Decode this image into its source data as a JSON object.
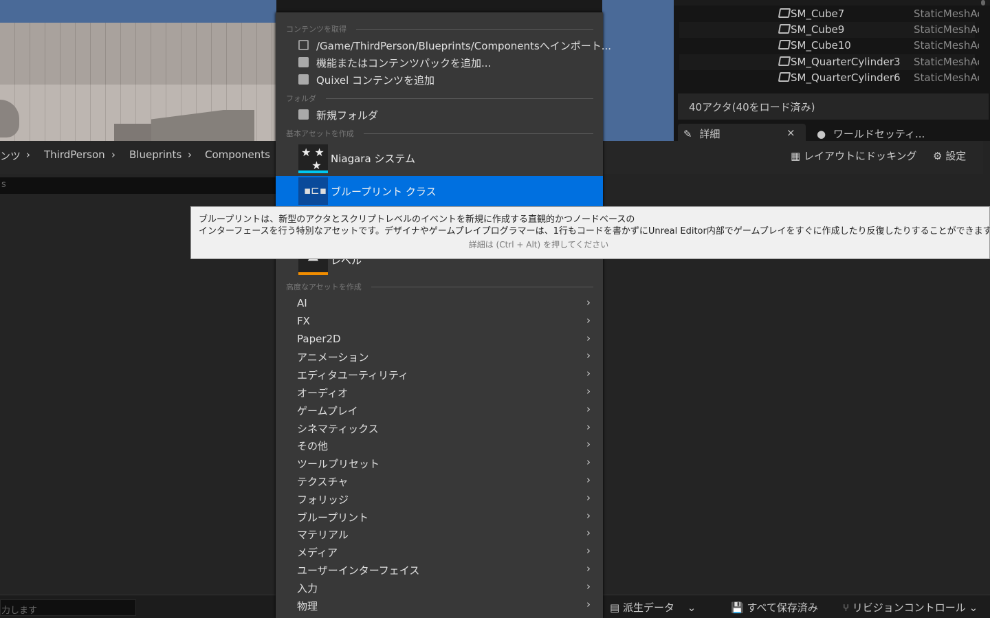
{
  "outliner": {
    "rows": [
      {
        "name": "SM_Cube7",
        "type": "StaticMeshActor"
      },
      {
        "name": "SM_Cube9",
        "type": "StaticMeshActor"
      },
      {
        "name": "SM_Cube10",
        "type": "StaticMeshActor"
      },
      {
        "name": "SM_QuarterCylinder3",
        "type": "StaticMeshActor"
      },
      {
        "name": "SM_QuarterCylinder6",
        "type": "StaticMeshActor"
      }
    ],
    "actor_count": "40アクタ(40をロード済み)"
  },
  "panel_tabs": {
    "details": "詳細",
    "close": "×",
    "world_settings": "ワールドセッティ..."
  },
  "toolbar": {
    "dock": "レイアウトにドッキング",
    "settings": "設定"
  },
  "breadcrumb": [
    "ンツ",
    "ThirdPerson",
    "Blueprints",
    "Components"
  ],
  "filter_text": "s",
  "bottom": {
    "search_placeholder": "力します",
    "derived_data": "派生データ",
    "save_all": "すべて保存済み",
    "revision_control": "リビジョンコントロール"
  },
  "menu": {
    "sections": {
      "get_content": "コンテンツを取得",
      "folder": "フォルダ",
      "basic_assets": "基本アセットを作成",
      "advanced_assets": "高度なアセットを作成"
    },
    "get_content_items": [
      "/Game/ThirdPerson/Blueprints/Componentsへインポート...",
      "機能またはコンテンツパックを追加...",
      "Quixel コンテンツを追加"
    ],
    "new_folder": "新規フォルダ",
    "basic": {
      "niagara": "Niagara システム",
      "blueprint_class": "ブループリント クラス",
      "level": "レベル"
    },
    "advanced": [
      "AI",
      "FX",
      "Paper2D",
      "アニメーション",
      "エディタユーティリティ",
      "オーディオ",
      "ゲームプレイ",
      "シネマティックス",
      "その他",
      "ツールプリセット",
      "テクスチャ",
      "フォリッジ",
      "ブループリント",
      "マテリアル",
      "メディア",
      "ユーザーインターフェイス",
      "入力",
      "物理"
    ]
  },
  "tooltip": {
    "line1": "ブループリントは、新型のアクタとスクリプトレベルのイベントを新規に作成する直観的かつノードベースの",
    "line2": "インターフェースを行う特別なアセットです。デザイナやゲームプレイプログラマーは、1行もコードを書かずにUnreal Editor内部でゲームプレイをすぐに作成したり反復したりすることができます",
    "hint": "詳細は (Ctrl + Alt) を押してください"
  },
  "colors": {
    "highlight": "#0070e0",
    "niagara_bar": "#00c8f0",
    "level_bar": "#f08c00"
  }
}
